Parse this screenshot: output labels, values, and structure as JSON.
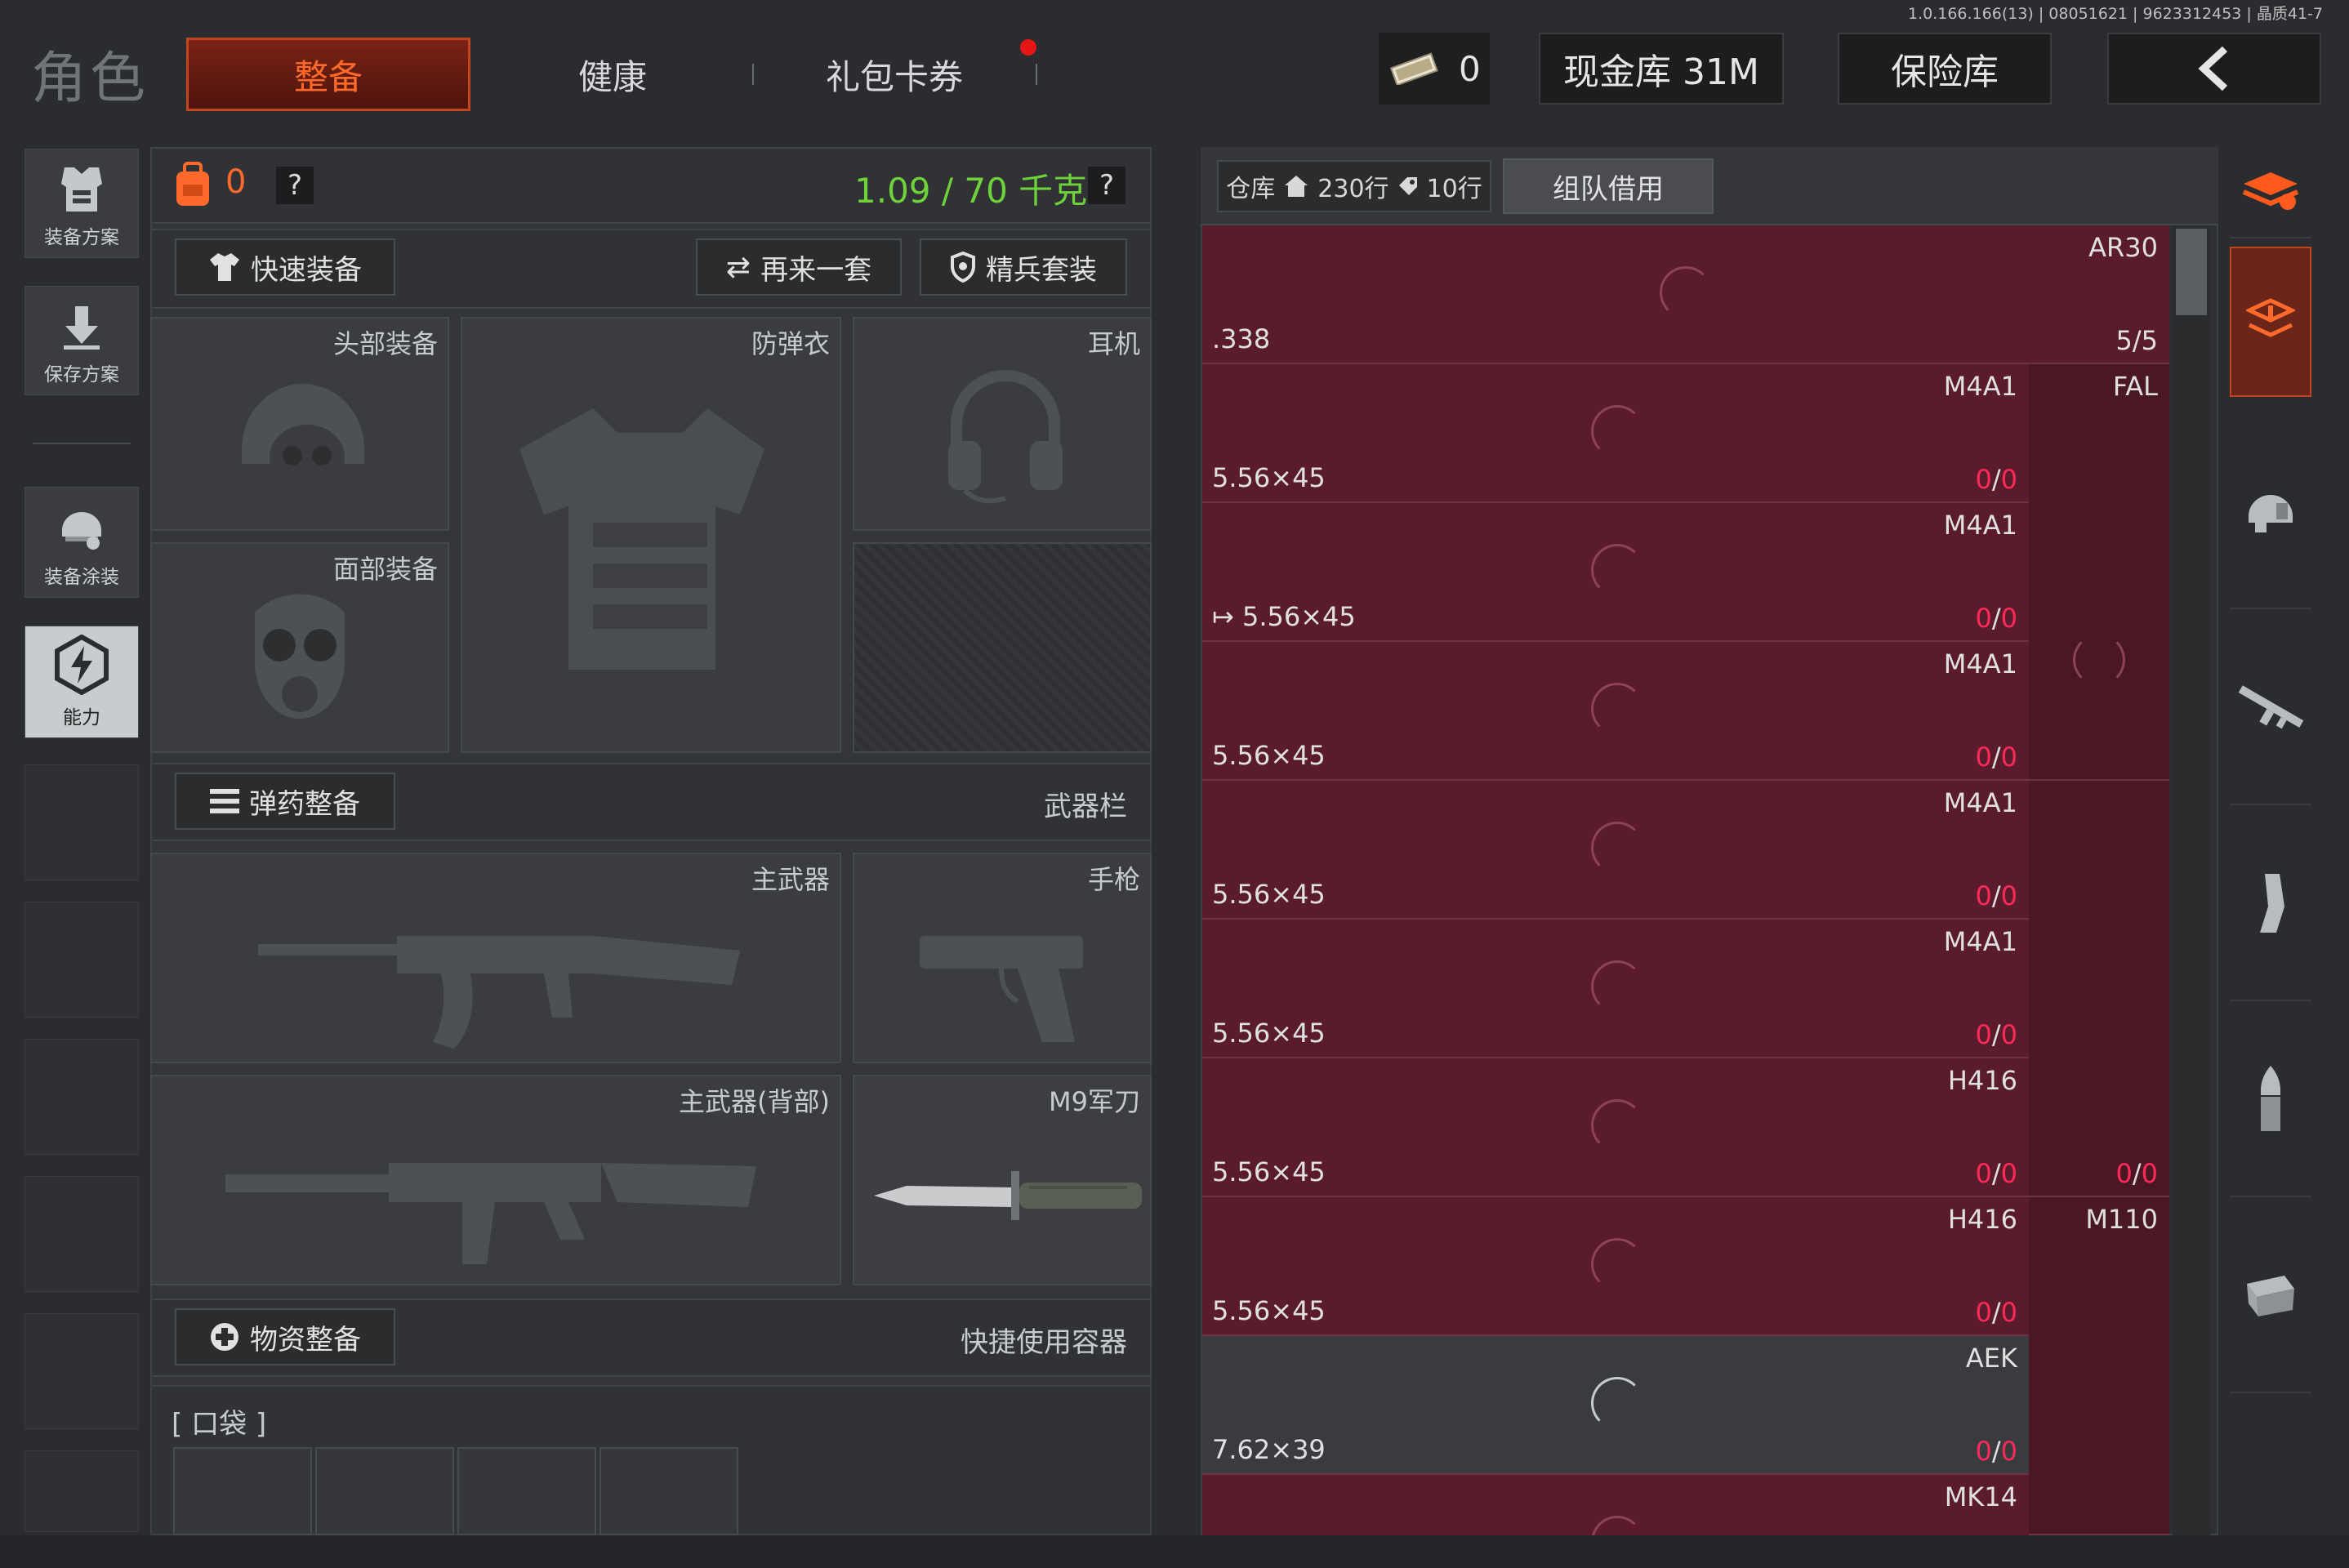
{
  "version": "1.0.166.166(13) | 08051621 | 9623312453 | 晶质41-7",
  "header": {
    "title": "角色",
    "tabs": [
      {
        "label": "整备",
        "active": true
      },
      {
        "label": "健康",
        "active": false
      },
      {
        "label": "礼包卡券",
        "active": false
      }
    ],
    "currency_value": "0",
    "cash_vault": "现金库 31M",
    "safe": "保险库",
    "back_icon": "chevron-left-icon"
  },
  "sidebar": {
    "items": [
      {
        "label": "装备方案",
        "icon": "vest-icon"
      },
      {
        "label": "保存方案",
        "icon": "download-icon"
      },
      {
        "label": "装备涂装",
        "icon": "helmet-paint-icon"
      },
      {
        "label": "能力",
        "icon": "lightning-icon",
        "active": true
      }
    ]
  },
  "equipment": {
    "bag_count": "0",
    "weight": "1.09 / 70 千克",
    "weight_color": "#6ed23a",
    "quick_equip": "快速装备",
    "another_set": "再来一套",
    "elite_set": "精兵套装",
    "slots": {
      "head": "头部装备",
      "armor": "防弹衣",
      "headset": "耳机",
      "face": "面部装备"
    },
    "ammo_section": "弹药整备",
    "weapon_bar": "武器栏",
    "primary": "主武器",
    "pistol": "手枪",
    "primary_back": "主武器(背部)",
    "knife": "M9军刀",
    "supply_section": "物资整备",
    "quick_container": "快捷使用容器",
    "pocket": "[ 口袋 ]"
  },
  "warehouse": {
    "label": "仓库",
    "rows_home": "230行",
    "rows_tag": "10行",
    "team_borrow": "组队借用",
    "rows": [
      {
        "name": "",
        "caliber": ".338",
        "count": "",
        "right_name": "AR30",
        "right_count": "5/5"
      },
      {
        "name": "M4A1",
        "caliber": "5.56×45",
        "count_a": "0",
        "count_b": "0",
        "right_name": "FAL",
        "right_count": ""
      },
      {
        "name": "M4A1",
        "caliber": "5.56×45",
        "count_a": "0",
        "count_b": "0",
        "right_name": "",
        "right_count": ""
      },
      {
        "name": "M4A1",
        "caliber": "5.56×45",
        "count_a": "0",
        "count_b": "0",
        "right_name": "",
        "right_count": ""
      },
      {
        "name": "M4A1",
        "caliber": "5.56×45",
        "count_a": "0",
        "count_b": "0",
        "right_name": "",
        "right_count": ""
      },
      {
        "name": "M4A1",
        "caliber": "5.56×45",
        "count_a": "0",
        "count_b": "0",
        "right_name": "",
        "right_count": ""
      },
      {
        "name": "H416",
        "caliber": "5.56×45",
        "count_a": "0",
        "count_b": "0",
        "right_name": "",
        "right_count_a": "0",
        "right_count_b": "0"
      },
      {
        "name": "H416",
        "caliber": "5.56×45",
        "count_a": "0",
        "count_b": "0",
        "right_name": "M110",
        "right_count": ""
      },
      {
        "name": "AEK",
        "caliber": "7.62×39",
        "count_a": "0",
        "count_b": "0",
        "right_name": "",
        "right_count": ""
      },
      {
        "name": "MK14",
        "caliber": "",
        "count_a": "",
        "count_b": "",
        "right_name": "",
        "right_count": ""
      }
    ]
  },
  "colors": {
    "accent": "#ff6a2a",
    "item_bg": "#5a1c2c",
    "count_red": "#ff2a5a"
  }
}
